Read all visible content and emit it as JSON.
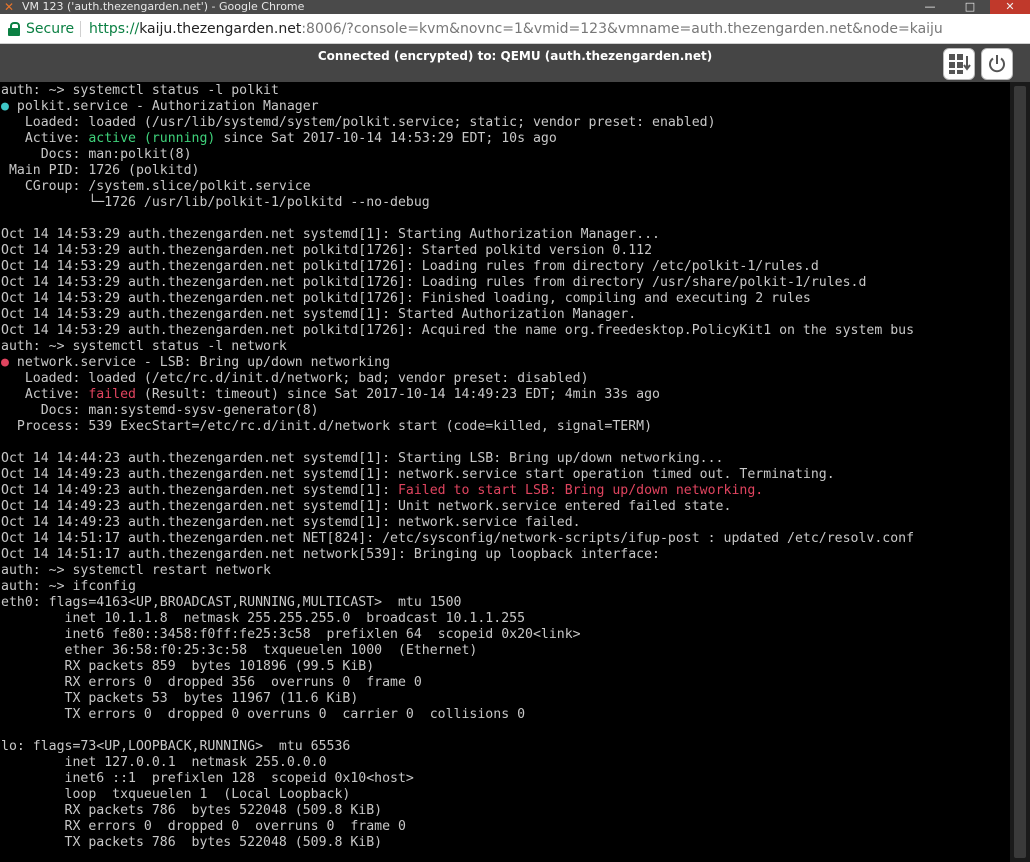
{
  "window": {
    "title": "VM 123 ('auth.thezengarden.net') - Google Chrome",
    "controls": [
      "—",
      "□",
      "✕"
    ]
  },
  "address_bar": {
    "secure_label": "Secure",
    "url_scheme": "https://",
    "url_host": "kaiju.thezengarden.net",
    "url_rest": ":8006/?console=kvm&novnc=1&vmid=123&vmname=auth.thezengarden.net&node=kaiju"
  },
  "novnc": {
    "status": "Connected (encrypted) to: QEMU (auth.thezengarden.net)",
    "keys_icon": "keyboard-icon",
    "power_icon": "power-icon"
  },
  "colors": {
    "terminal_bg": "#000000",
    "terminal_fg": "#c8c8c8",
    "active_green": "#3fd17a",
    "failed_red": "#e0445f",
    "secure_green": "#0b8043"
  },
  "terminal": {
    "lines": [
      {
        "segments": [
          {
            "text": "auth: ~> systemctl status -l polkit"
          }
        ]
      },
      {
        "segments": [
          {
            "text": "●",
            "style": "cyan"
          },
          {
            "text": " polkit.service - Authorization Manager"
          }
        ]
      },
      {
        "segments": [
          {
            "text": "   Loaded: loaded (/usr/lib/systemd/system/polkit.service; static; vendor preset: enabled)"
          }
        ]
      },
      {
        "segments": [
          {
            "text": "   Active: "
          },
          {
            "text": "active (running)",
            "style": "green"
          },
          {
            "text": " since Sat 2017-10-14 14:53:29 EDT; 10s ago"
          }
        ]
      },
      {
        "segments": [
          {
            "text": "     Docs: man:polkit(8)"
          }
        ]
      },
      {
        "segments": [
          {
            "text": " Main PID: 1726 (polkitd)"
          }
        ]
      },
      {
        "segments": [
          {
            "text": "   CGroup: /system.slice/polkit.service"
          }
        ]
      },
      {
        "segments": [
          {
            "text": "           └─1726 /usr/lib/polkit-1/polkitd --no-debug"
          }
        ]
      },
      {
        "segments": [
          {
            "text": ""
          }
        ]
      },
      {
        "segments": [
          {
            "text": "Oct 14 14:53:29 auth.thezengarden.net systemd[1]: Starting Authorization Manager..."
          }
        ]
      },
      {
        "segments": [
          {
            "text": "Oct 14 14:53:29 auth.thezengarden.net polkitd[1726]: Started polkitd version 0.112"
          }
        ]
      },
      {
        "segments": [
          {
            "text": "Oct 14 14:53:29 auth.thezengarden.net polkitd[1726]: Loading rules from directory /etc/polkit-1/rules.d"
          }
        ]
      },
      {
        "segments": [
          {
            "text": "Oct 14 14:53:29 auth.thezengarden.net polkitd[1726]: Loading rules from directory /usr/share/polkit-1/rules.d"
          }
        ]
      },
      {
        "segments": [
          {
            "text": "Oct 14 14:53:29 auth.thezengarden.net polkitd[1726]: Finished loading, compiling and executing 2 rules"
          }
        ]
      },
      {
        "segments": [
          {
            "text": "Oct 14 14:53:29 auth.thezengarden.net systemd[1]: Started Authorization Manager."
          }
        ]
      },
      {
        "segments": [
          {
            "text": "Oct 14 14:53:29 auth.thezengarden.net polkitd[1726]: Acquired the name org.freedesktop.PolicyKit1 on the system bus"
          }
        ]
      },
      {
        "segments": [
          {
            "text": "auth: ~> systemctl status -l network"
          }
        ]
      },
      {
        "segments": [
          {
            "text": "●",
            "style": "pink"
          },
          {
            "text": " network.service - LSB: Bring up/down networking"
          }
        ]
      },
      {
        "segments": [
          {
            "text": "   Loaded: loaded (/etc/rc.d/init.d/network; bad; vendor preset: disabled)"
          }
        ]
      },
      {
        "segments": [
          {
            "text": "   Active: "
          },
          {
            "text": "failed",
            "style": "red"
          },
          {
            "text": " (Result: timeout) since Sat 2017-10-14 14:49:23 EDT; 4min 33s ago"
          }
        ]
      },
      {
        "segments": [
          {
            "text": "     Docs: man:systemd-sysv-generator(8)"
          }
        ]
      },
      {
        "segments": [
          {
            "text": "  Process: 539 ExecStart=/etc/rc.d/init.d/network start (code=killed, signal=TERM)"
          }
        ]
      },
      {
        "segments": [
          {
            "text": ""
          }
        ]
      },
      {
        "segments": [
          {
            "text": "Oct 14 14:44:23 auth.thezengarden.net systemd[1]: Starting LSB: Bring up/down networking..."
          }
        ]
      },
      {
        "segments": [
          {
            "text": "Oct 14 14:49:23 auth.thezengarden.net systemd[1]: network.service start operation timed out. Terminating."
          }
        ]
      },
      {
        "segments": [
          {
            "text": "Oct 14 14:49:23 auth.thezengarden.net systemd[1]: "
          },
          {
            "text": "Failed to start LSB: Bring up/down networking.",
            "style": "red"
          }
        ]
      },
      {
        "segments": [
          {
            "text": "Oct 14 14:49:23 auth.thezengarden.net systemd[1]: Unit network.service entered failed state."
          }
        ]
      },
      {
        "segments": [
          {
            "text": "Oct 14 14:49:23 auth.thezengarden.net systemd[1]: network.service failed."
          }
        ]
      },
      {
        "segments": [
          {
            "text": "Oct 14 14:51:17 auth.thezengarden.net NET[824]: /etc/sysconfig/network-scripts/ifup-post : updated /etc/resolv.conf"
          }
        ]
      },
      {
        "segments": [
          {
            "text": "Oct 14 14:51:17 auth.thezengarden.net network[539]: Bringing up loopback interface:"
          }
        ]
      },
      {
        "segments": [
          {
            "text": "auth: ~> systemctl restart network"
          }
        ]
      },
      {
        "segments": [
          {
            "text": "auth: ~> ifconfig"
          }
        ]
      },
      {
        "segments": [
          {
            "text": "eth0: flags=4163<UP,BROADCAST,RUNNING,MULTICAST>  mtu 1500"
          }
        ]
      },
      {
        "segments": [
          {
            "text": "        inet 10.1.1.8  netmask 255.255.255.0  broadcast 10.1.1.255"
          }
        ]
      },
      {
        "segments": [
          {
            "text": "        inet6 fe80::3458:f0ff:fe25:3c58  prefixlen 64  scopeid 0x20<link>"
          }
        ]
      },
      {
        "segments": [
          {
            "text": "        ether 36:58:f0:25:3c:58  txqueuelen 1000  (Ethernet)"
          }
        ]
      },
      {
        "segments": [
          {
            "text": "        RX packets 859  bytes 101896 (99.5 KiB)"
          }
        ]
      },
      {
        "segments": [
          {
            "text": "        RX errors 0  dropped 356  overruns 0  frame 0"
          }
        ]
      },
      {
        "segments": [
          {
            "text": "        TX packets 53  bytes 11967 (11.6 KiB)"
          }
        ]
      },
      {
        "segments": [
          {
            "text": "        TX errors 0  dropped 0 overruns 0  carrier 0  collisions 0"
          }
        ]
      },
      {
        "segments": [
          {
            "text": ""
          }
        ]
      },
      {
        "segments": [
          {
            "text": "lo: flags=73<UP,LOOPBACK,RUNNING>  mtu 65536"
          }
        ]
      },
      {
        "segments": [
          {
            "text": "        inet 127.0.0.1  netmask 255.0.0.0"
          }
        ]
      },
      {
        "segments": [
          {
            "text": "        inet6 ::1  prefixlen 128  scopeid 0x10<host>"
          }
        ]
      },
      {
        "segments": [
          {
            "text": "        loop  txqueuelen 1  (Local Loopback)"
          }
        ]
      },
      {
        "segments": [
          {
            "text": "        RX packets 786  bytes 522048 (509.8 KiB)"
          }
        ]
      },
      {
        "segments": [
          {
            "text": "        RX errors 0  dropped 0  overruns 0  frame 0"
          }
        ]
      },
      {
        "segments": [
          {
            "text": "        TX packets 786  bytes 522048 (509.8 KiB)"
          }
        ]
      }
    ]
  }
}
